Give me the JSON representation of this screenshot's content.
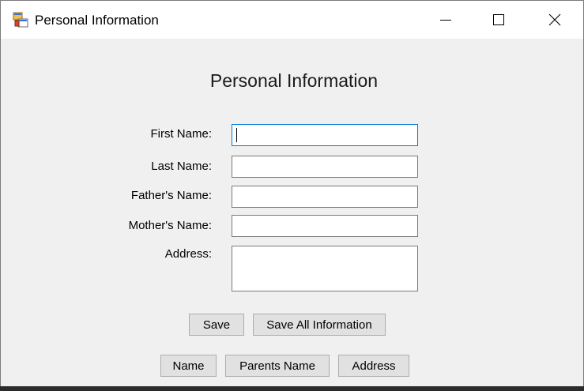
{
  "window": {
    "title": "Personal Information"
  },
  "form": {
    "heading": "Personal Information",
    "fields": {
      "first_name": {
        "label": "First Name:",
        "value": ""
      },
      "last_name": {
        "label": "Last Name:",
        "value": ""
      },
      "father_name": {
        "label": "Father's Name:",
        "value": ""
      },
      "mother_name": {
        "label": "Mother's Name:",
        "value": ""
      },
      "address": {
        "label": "Address:",
        "value": ""
      }
    }
  },
  "buttons": {
    "save": "Save",
    "save_all": "Save All Information",
    "name": "Name",
    "parents_name": "Parents Name",
    "address": "Address"
  },
  "icons": {
    "app": "app-icon",
    "minimize": "minimize-icon",
    "maximize": "maximize-icon",
    "close": "close-icon"
  },
  "colors": {
    "focus_border": "#0078d7",
    "window_bg": "#f0f0f0",
    "button_bg": "#e1e1e1"
  }
}
